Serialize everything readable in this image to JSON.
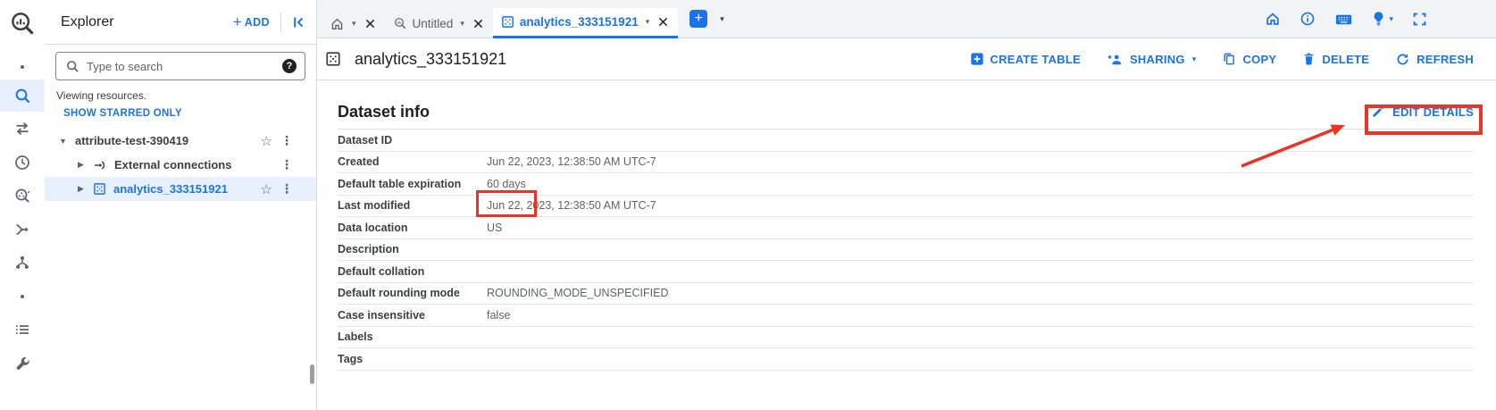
{
  "colors": {
    "accent": "#1a73e8",
    "annotation_red": "#ea3425",
    "selected_row_bg": "#e8f0fe"
  },
  "glyphs": {
    "star": "☆",
    "kebab": "⋮",
    "caret_down": "▾",
    "caret_right": "▶",
    "caret_expand": "▼",
    "plus": "+",
    "help": "?"
  },
  "explorer": {
    "title": "Explorer",
    "add_button": "ADD",
    "search": {
      "placeholder": "Type to search"
    },
    "status_text": "Viewing resources.",
    "starred_filter": "SHOW STARRED ONLY",
    "tree": {
      "project": {
        "label": "attribute-test-390419"
      },
      "children": [
        {
          "label": "External connections"
        },
        {
          "label": "analytics_333151921"
        }
      ]
    }
  },
  "tabbar": {
    "tabs": [
      {
        "label": ""
      },
      {
        "label": "Untitled"
      },
      {
        "label": "analytics_333151921"
      }
    ]
  },
  "main": {
    "title": "analytics_333151921",
    "actions": {
      "create_table": "CREATE TABLE",
      "sharing": "SHARING",
      "copy": "COPY",
      "delete": "DELETE",
      "refresh": "REFRESH"
    },
    "dataset_info": {
      "heading": "Dataset info",
      "edit_button": "EDIT DETAILS",
      "rows": [
        {
          "label": "Dataset ID",
          "value": ""
        },
        {
          "label": "Created",
          "value": "Jun 22, 2023, 12:38:50 AM UTC-7"
        },
        {
          "label": "Default table expiration",
          "value": "60 days"
        },
        {
          "label": "Last modified",
          "value": "Jun 22, 2023, 12:38:50 AM UTC-7"
        },
        {
          "label": "Data location",
          "value": "US"
        },
        {
          "label": "Description",
          "value": ""
        },
        {
          "label": "Default collation",
          "value": ""
        },
        {
          "label": "Default rounding mode",
          "value": "ROUNDING_MODE_UNSPECIFIED"
        },
        {
          "label": "Case insensitive",
          "value": "false"
        },
        {
          "label": "Labels",
          "value": ""
        },
        {
          "label": "Tags",
          "value": ""
        }
      ]
    }
  }
}
